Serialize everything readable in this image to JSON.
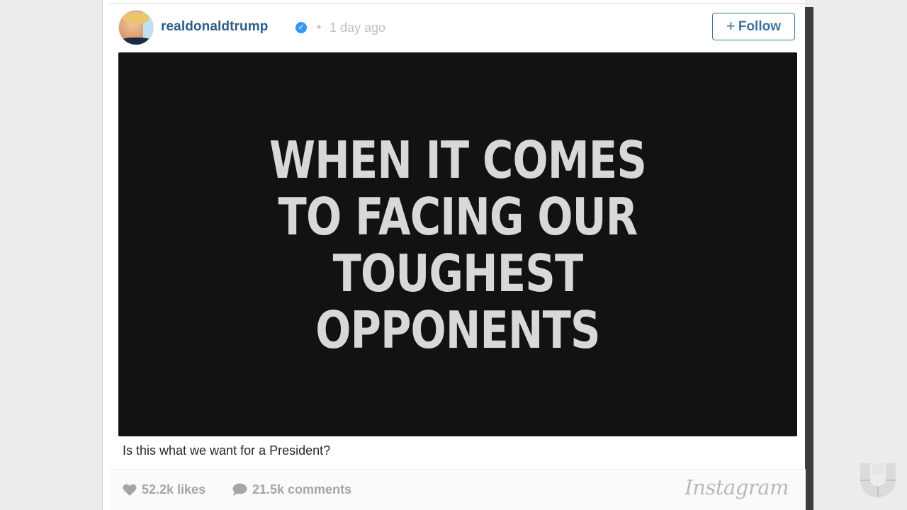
{
  "post": {
    "username": "realdonaldtrump",
    "verified_icon": "check-badge-icon",
    "separator": "•",
    "timestamp": "1 day ago",
    "follow_plus": "+",
    "follow_label": "Follow",
    "media_lines": [
      "WHEN IT COMES",
      "TO FACING OUR",
      "TOUGHEST",
      "OPPONENTS"
    ],
    "caption": "Is this what we want for a President?",
    "likes": "52.2k likes",
    "comments": "21.5k comments",
    "brand": "Instagram"
  },
  "colors": {
    "username": "#2d5d88",
    "follow_accent": "#3f729b",
    "verified": "#3897f0",
    "media_bg": "#121212",
    "media_text": "#d8d8d8",
    "meta_gray": "#a5a5a5"
  }
}
